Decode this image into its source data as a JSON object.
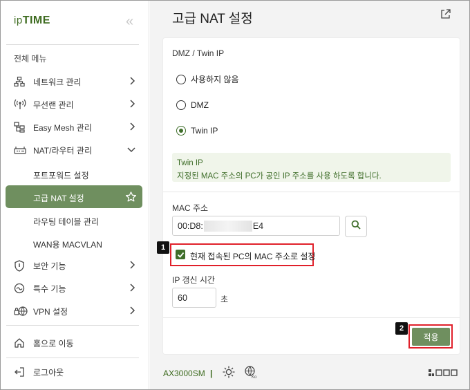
{
  "brand": {
    "logo_ip": "ip",
    "logo_time": "TIME"
  },
  "sidebar": {
    "collapse_glyph": "«",
    "menu_title": "전체 메뉴",
    "items": [
      {
        "label": "네트워크 관리",
        "icon": "network-icon"
      },
      {
        "label": "무선랜 관리",
        "icon": "wireless-icon"
      },
      {
        "label": "Easy Mesh 관리",
        "icon": "mesh-icon"
      },
      {
        "label": "NAT/라우터 관리",
        "icon": "router-icon"
      }
    ],
    "sub_items": [
      {
        "label": "포트포워드 설정"
      },
      {
        "label": "고급 NAT 설정"
      },
      {
        "label": "라우팅 테이블 관리"
      },
      {
        "label": "WAN용 MACVLAN"
      }
    ],
    "items2": [
      {
        "label": "보안 기능",
        "icon": "shield-icon"
      },
      {
        "label": "특수 기능",
        "icon": "special-icon"
      },
      {
        "label": "VPN 설정",
        "icon": "vpn-icon"
      }
    ],
    "home_label": "홈으로 이동",
    "logout_label": "로그아웃"
  },
  "main": {
    "title": "고급 NAT 설정",
    "dmz_section": "DMZ / Twin IP",
    "options": [
      "사용하지 않음",
      "DMZ",
      "Twin IP"
    ],
    "selected_option": "Twin IP",
    "info_title": "Twin IP",
    "info_text": "지정된 MAC 주소의 PC가 공인 IP 주소를 사용 하도록 합니다.",
    "mac_label": "MAC 주소",
    "mac_prefix": "00:D8:",
    "mac_suffix": "E4",
    "use_current_label": "현재 접속된 PC의 MAC 주소로 설정",
    "use_current_checked": true,
    "ip_renew_label": "IP 갱신 시간",
    "ip_renew_value": "60",
    "ip_renew_unit": "초",
    "apply_label": "적용",
    "badge1": "1",
    "badge2": "2"
  },
  "footer": {
    "model": "AX3000SM",
    "separator": "|"
  },
  "colors": {
    "accent": "#6f8f5f",
    "brand": "#3d6b1f",
    "highlight": "#e0202a"
  }
}
